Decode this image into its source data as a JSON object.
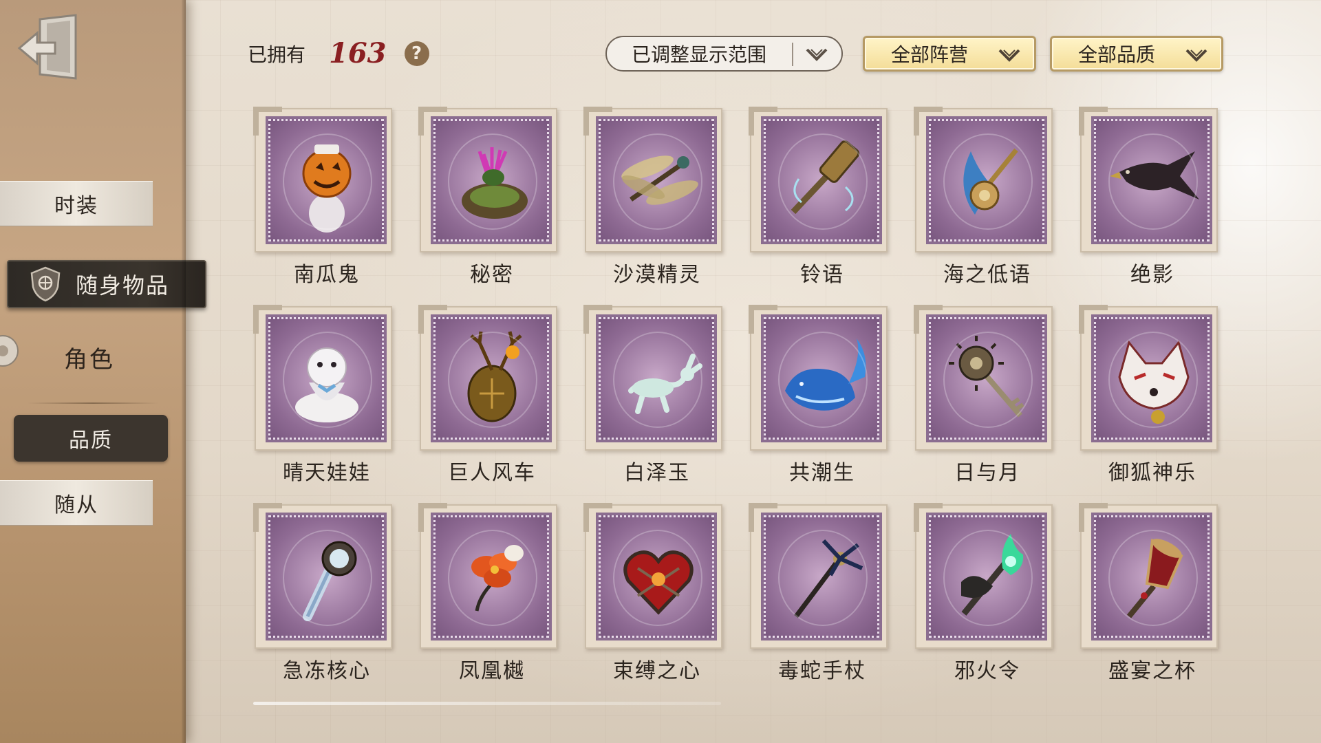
{
  "header": {
    "owned_label": "已拥有",
    "owned_count": "163",
    "help_glyph": "?"
  },
  "filters": {
    "range_label": "已调整显示范围",
    "faction_label": "全部阵营",
    "quality_label": "全部品质"
  },
  "sidebar": {
    "fashion": "时装",
    "accessory": "随身物品",
    "role": "角色",
    "quality": "品质",
    "follower": "随从"
  },
  "colors": {
    "owned_count": "#8a1f22",
    "stamp_purple": "#a886ab",
    "sidebar_active": "#2e2a25"
  },
  "items": [
    {
      "name": "南瓜鬼",
      "icon": "pumpkin-ghost-icon"
    },
    {
      "name": "秘密",
      "icon": "thistle-flower-icon"
    },
    {
      "name": "沙漠精灵",
      "icon": "dragonfly-icon"
    },
    {
      "name": "铃语",
      "icon": "bell-scepter-icon"
    },
    {
      "name": "海之低语",
      "icon": "seashell-trident-icon"
    },
    {
      "name": "绝影",
      "icon": "black-bird-icon"
    },
    {
      "name": "晴天娃娃",
      "icon": "sunny-doll-icon"
    },
    {
      "name": "巨人风车",
      "icon": "antler-windmill-icon"
    },
    {
      "name": "白泽玉",
      "icon": "jade-deer-icon"
    },
    {
      "name": "共潮生",
      "icon": "blue-whale-icon"
    },
    {
      "name": "日与月",
      "icon": "sun-moon-key-icon"
    },
    {
      "name": "御狐神乐",
      "icon": "fox-mask-icon"
    },
    {
      "name": "急冻核心",
      "icon": "frozen-core-icon"
    },
    {
      "name": "凤凰樾",
      "icon": "phoenix-flower-icon"
    },
    {
      "name": "束缚之心",
      "icon": "bound-heart-icon"
    },
    {
      "name": "毒蛇手杖",
      "icon": "serpent-cane-icon"
    },
    {
      "name": "邪火令",
      "icon": "evil-fire-token-icon"
    },
    {
      "name": "盛宴之杯",
      "icon": "feast-goblet-icon"
    }
  ]
}
